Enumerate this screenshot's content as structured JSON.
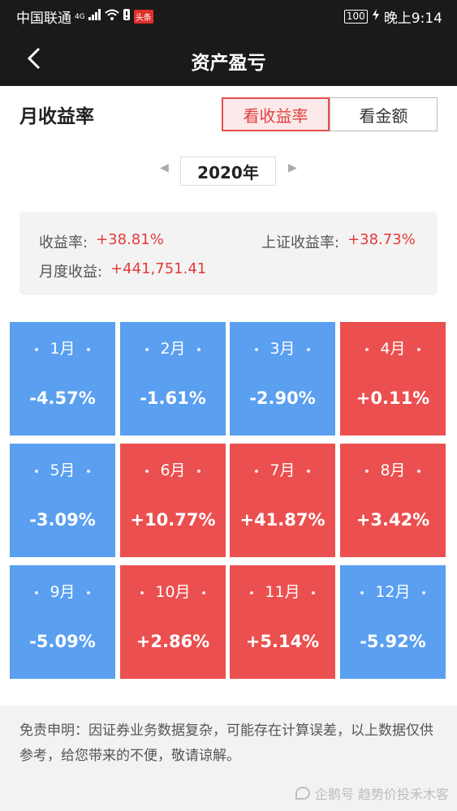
{
  "statusbar": {
    "carrier": "中国联通",
    "network": "4G",
    "wifi_icon": "wifi-icon",
    "app_badge": "头条",
    "battery": "100",
    "time": "晚上9:14"
  },
  "navbar": {
    "back_icon": "chevron-left-icon",
    "title": "资产盈亏"
  },
  "section": {
    "title": "月收益率",
    "toggle": [
      {
        "label": "看收益率",
        "active": true
      },
      {
        "label": "看金额",
        "active": false
      }
    ]
  },
  "year_selector": {
    "prev": "◀",
    "year": "2020年",
    "next": "▶"
  },
  "summary": {
    "return_label": "收益率:",
    "return_value": "+38.81%",
    "index_label": "上证收益率:",
    "index_value": "+38.73%",
    "monthly_label": "月度收益:",
    "monthly_value": "+441,751.41"
  },
  "months": [
    {
      "month": "1月",
      "value": "-4.57%",
      "pct": -4.57
    },
    {
      "month": "2月",
      "value": "-1.61%",
      "pct": -1.61
    },
    {
      "month": "3月",
      "value": "-2.90%",
      "pct": -2.9
    },
    {
      "month": "4月",
      "value": "+0.11%",
      "pct": 0.11
    },
    {
      "month": "5月",
      "value": "-3.09%",
      "pct": -3.09
    },
    {
      "month": "6月",
      "value": "+10.77%",
      "pct": 10.77
    },
    {
      "month": "7月",
      "value": "+41.87%",
      "pct": 41.87
    },
    {
      "month": "8月",
      "value": "+3.42%",
      "pct": 3.42
    },
    {
      "month": "9月",
      "value": "-5.09%",
      "pct": -5.09
    },
    {
      "month": "10月",
      "value": "+2.86%",
      "pct": 2.86
    },
    {
      "month": "11月",
      "value": "+5.14%",
      "pct": 5.14
    },
    {
      "month": "12月",
      "value": "-5.92%",
      "pct": -5.92
    }
  ],
  "colors": {
    "positive": "#ec4f4f",
    "negative": "#5a9ff0",
    "accent": "#e24040"
  },
  "disclaimer": "免责申明：因证券业务数据复杂，可能存在计算误差，以上数据仅供参考，给您带来的不便，敬请谅解。",
  "watermark": "企鹅号 趋势价投禾木客"
}
